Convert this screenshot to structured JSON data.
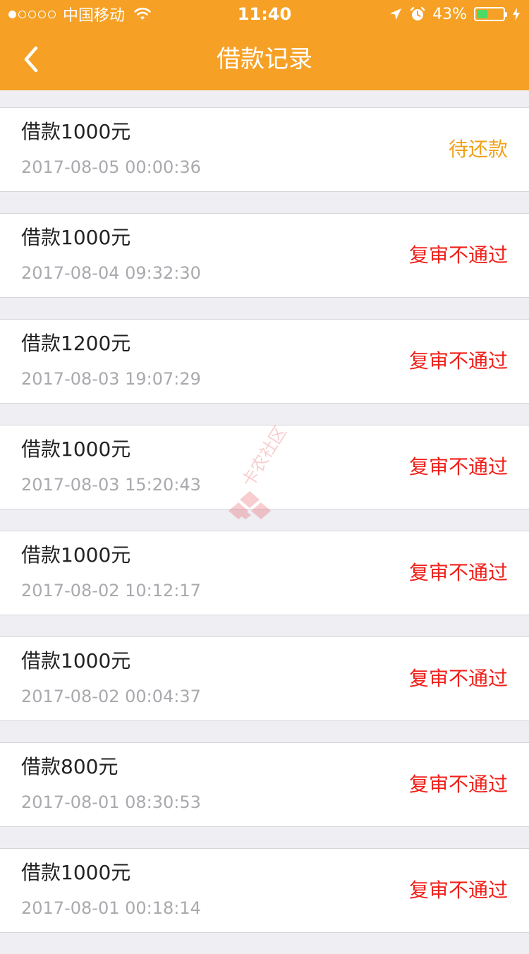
{
  "status_bar": {
    "carrier": "中国移动",
    "time": "11:40",
    "battery_percent": "43%",
    "battery_level": 0.43,
    "signal_bars_filled": 1,
    "signal_bars_total": 5,
    "icons": [
      "wifi-icon",
      "location-arrow-icon",
      "alarm-icon",
      "battery-icon",
      "charging-bolt-icon"
    ]
  },
  "nav": {
    "title": "借款记录",
    "back_icon": "chevron-left-icon"
  },
  "colors": {
    "header": "#f6a125",
    "status_pending": "#f0a21a",
    "status_rejected": "#f0201a"
  },
  "records": [
    {
      "title": "借款1000元",
      "time": "2017-08-05 00:00:36",
      "status": "待还款",
      "status_color": "#f0a21a"
    },
    {
      "title": "借款1000元",
      "time": "2017-08-04 09:32:30",
      "status": "复审不通过",
      "status_color": "#f0201a"
    },
    {
      "title": "借款1200元",
      "time": "2017-08-03 19:07:29",
      "status": "复审不通过",
      "status_color": "#f0201a"
    },
    {
      "title": "借款1000元",
      "time": "2017-08-03 15:20:43",
      "status": "复审不通过",
      "status_color": "#f0201a"
    },
    {
      "title": "借款1000元",
      "time": "2017-08-02 10:12:17",
      "status": "复审不通过",
      "status_color": "#f0201a"
    },
    {
      "title": "借款1000元",
      "time": "2017-08-02 00:04:37",
      "status": "复审不通过",
      "status_color": "#f0201a"
    },
    {
      "title": "借款800元",
      "time": "2017-08-01 08:30:53",
      "status": "复审不通过",
      "status_color": "#f0201a"
    },
    {
      "title": "借款1000元",
      "time": "2017-08-01 00:18:14",
      "status": "复审不通过",
      "status_color": "#f0201a"
    }
  ],
  "watermark": {
    "text": "卡农社区",
    "icon": "kanong-logo-icon"
  }
}
